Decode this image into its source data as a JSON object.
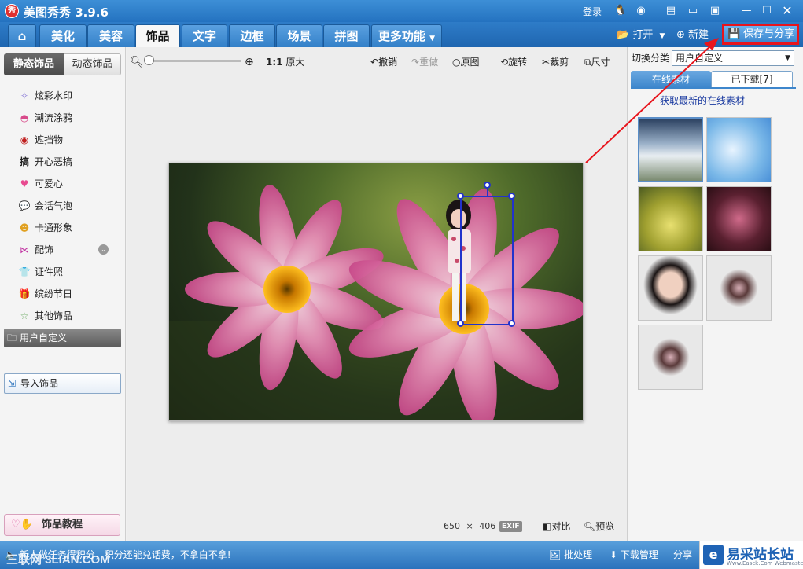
{
  "app": {
    "logo_text": "秀",
    "title": "美图秀秀 3.9.6",
    "login": "登录"
  },
  "tabs": [
    "美化",
    "美容",
    "饰品",
    "文字",
    "边框",
    "场景",
    "拼图"
  ],
  "active_tab": "饰品",
  "more_tab": "更多功能",
  "top_actions": {
    "open": "打开",
    "new": "新建",
    "save_share": "保存与分享"
  },
  "left_panel": {
    "static_tab": "静态饰品",
    "dynamic_tab": "动态饰品",
    "categories": [
      "炫彩水印",
      "潮流涂鸦",
      "遮挡物",
      "开心恶搞",
      "可爱心",
      "会话气泡",
      "卡通形象",
      "配饰",
      "证件照",
      "缤纷节日",
      "其他饰品"
    ],
    "custom_category": "用户自定义",
    "import_button": "导入饰品",
    "tutorial_button": "饰品教程",
    "gao_icon": "搞"
  },
  "canvas_toolbar": {
    "zoom_ratio": "1:1",
    "original_size": "原大",
    "undo": "撤销",
    "redo": "重做",
    "original": "原图",
    "rotate": "旋转",
    "crop": "裁剪",
    "resize": "尺寸"
  },
  "canvas_status": {
    "width": "650",
    "times": "×",
    "height": "406",
    "exif": "EXIF",
    "compare": "对比",
    "preview": "预览"
  },
  "right_panel": {
    "switch_label": "切换分类",
    "selected_category": "用户自定义",
    "online_tab": "在线素材",
    "downloaded_tab": "已下载[7]",
    "fetch_link": "获取最新的在线素材"
  },
  "statusbar": {
    "ticker": "新人做任务得积分，积分还能兑话费，不拿白不拿!",
    "batch": "批处理",
    "download": "下载管理",
    "share": "分享",
    "watermark": "易采站长站",
    "watermark_sub": "Www.Easck.Com Webmaster",
    "watermark_left": "三联网 3LIAN.COM"
  },
  "colors": {
    "title_bar": "#2472c0",
    "highlight_red": "#e8141c",
    "selection_blue": "#2233cc"
  }
}
